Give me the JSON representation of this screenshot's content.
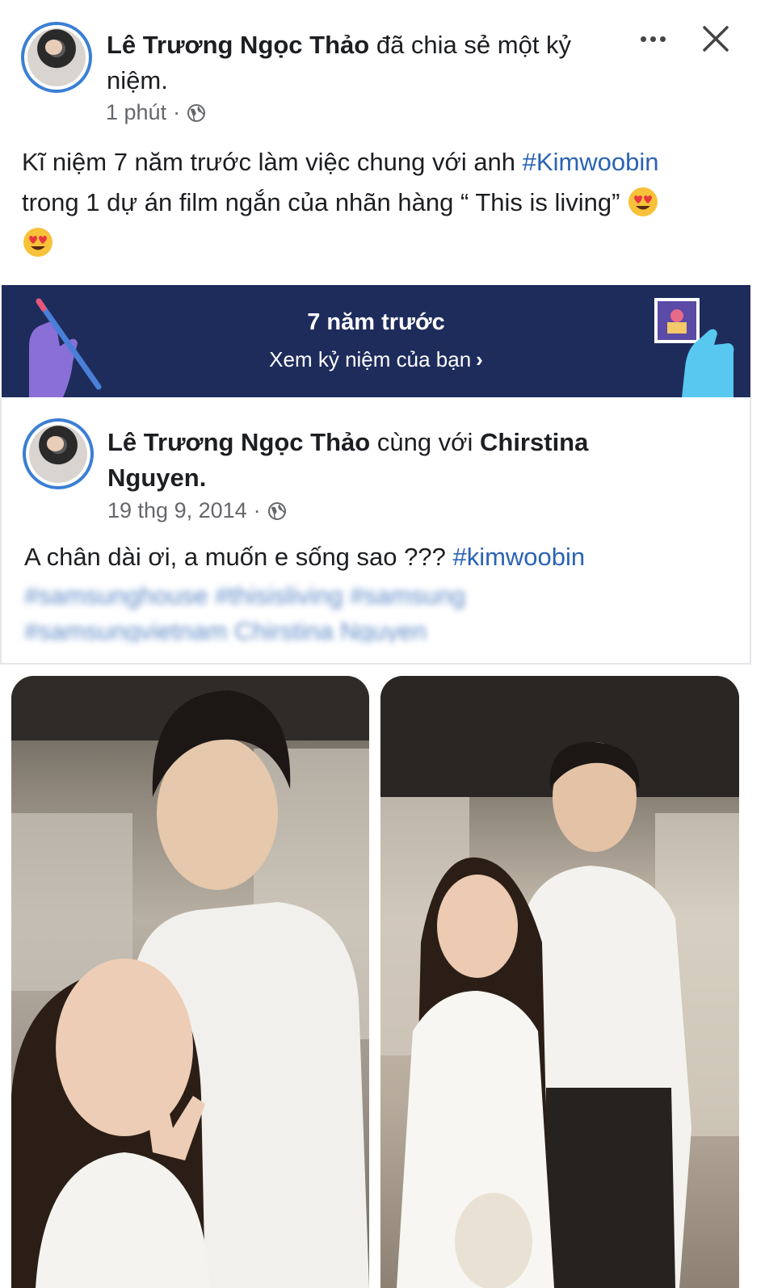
{
  "post": {
    "author": "Lê Trương Ngọc Thảo",
    "action": " đã chia sẻ một kỷ niệm.",
    "time": "1 phút",
    "dot": "·",
    "text_line1": "Kĩ niệm 7 năm trước làm việc chung với anh ",
    "hashtag1": "#Kimwoobin",
    "text_line2": "trong 1 dự án film ngắn của nhãn hàng “ This is living”",
    "icons": {
      "more": "more-options-icon",
      "close": "close-icon",
      "privacy": "globe-icon",
      "emoji": "heart-eyes-emoji-icon"
    }
  },
  "memory": {
    "title": "7 năm trước",
    "link": "Xem kỷ niệm của bạn",
    "chevron": "›",
    "colors": {
      "banner": "#1e2c5c",
      "hand_left": "#8a6fd6",
      "hand_right": "#59c8f0"
    }
  },
  "shared": {
    "author": "Lê Trương Ngọc Thảo",
    "with": " cùng với ",
    "tagged": "Chirstina Nguyen",
    "period": ".",
    "date": "19 thg 9, 2014",
    "dot": "·",
    "caption": "A chân dài ơi, a muốn e sống sao ??? ",
    "hashtag": "#kimwoobin",
    "blurred_line1": "#samsunghouse #thisisliving #samsung",
    "blurred_line2": "#samsungvietnam Chirstina Nguyen"
  },
  "photos": [
    {
      "name": "photo-selfie",
      "description_icon": "photo-icon"
    },
    {
      "name": "photo-standing",
      "description_icon": "photo-icon"
    }
  ],
  "colors": {
    "hashtag": "#2a63b5",
    "avatar_ring": "#3b7fd4",
    "meta": "#65676b"
  }
}
